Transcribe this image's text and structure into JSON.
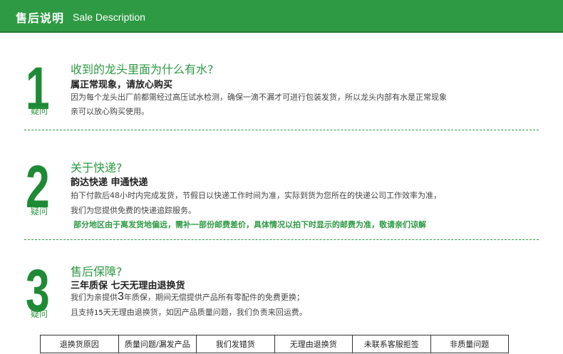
{
  "header": {
    "title_cn": "售后说明",
    "title_en": "Sale Description"
  },
  "sections": [
    {
      "number": "1",
      "tag": "疑问",
      "question": "收到的龙头里面为什么有水?",
      "bold": "属正常现象，请放心购买",
      "lines": [
        "因为每个龙头出厂前都需经过高压试水检测，确保一滴不漏才可进行包装发货，所以龙头内部有水是正常现象",
        "亲可以放心购买使用。"
      ]
    },
    {
      "number": "2",
      "tag": "疑问",
      "question": "关于快递?",
      "bold": "韵达快递  申通快递",
      "lines": [
        "拍下付款后48小时内完成发货，节假日以快递工作时间为准，实际到货为您所在的快递公司工作效率为准，",
        "我们为您提供免费的快递追踪服务。"
      ],
      "note": "部分地区由于离发货地偏远，需补一部份邮费差价，具体情况以拍下时显示的邮费为准，敬请亲们谅解"
    },
    {
      "number": "3",
      "tag": "疑问",
      "question": "售后保障?",
      "bold": "三年质保  七天无理由退换货",
      "line1": {
        "a": "我们为亲提供",
        "b": "3",
        "c": "年质保，期间无偿提供产品所有零配件的免费更换；"
      },
      "line2": {
        "a": "且支持",
        "b": "15",
        "c": "天无理由退换货，如因产品质量问题，我们负责来回运费。"
      }
    }
  ],
  "reasons": [
    "退换货原因",
    "质量问题/漏发产品",
    "我们发错货",
    "无理由退换货",
    "未联系客服拒签",
    "非质量问题"
  ]
}
